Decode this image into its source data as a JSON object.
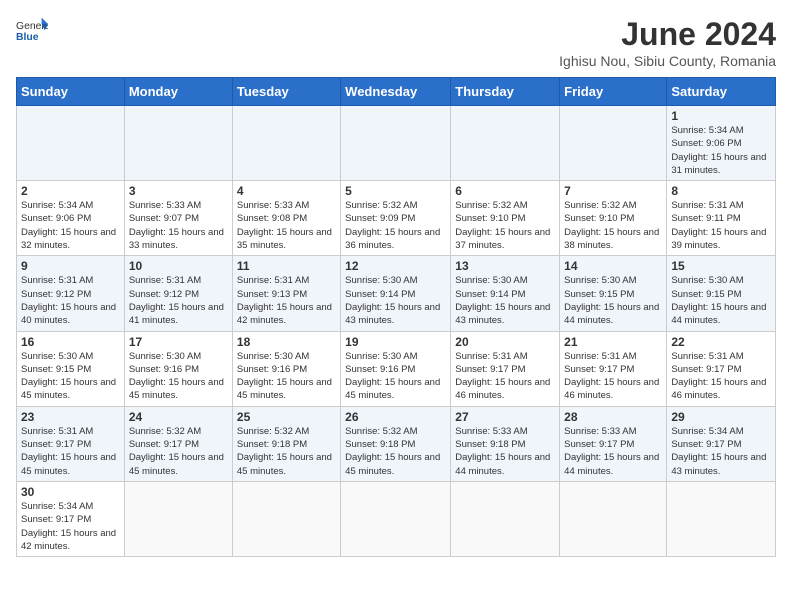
{
  "header": {
    "logo_general": "General",
    "logo_blue": "Blue",
    "month_year": "June 2024",
    "location": "Ighisu Nou, Sibiu County, Romania"
  },
  "days_of_week": [
    "Sunday",
    "Monday",
    "Tuesday",
    "Wednesday",
    "Thursday",
    "Friday",
    "Saturday"
  ],
  "weeks": [
    [
      {
        "day": "",
        "info": ""
      },
      {
        "day": "",
        "info": ""
      },
      {
        "day": "",
        "info": ""
      },
      {
        "day": "",
        "info": ""
      },
      {
        "day": "",
        "info": ""
      },
      {
        "day": "",
        "info": ""
      },
      {
        "day": "1",
        "info": "Sunrise: 5:34 AM\nSunset: 9:06 PM\nDaylight: 15 hours and 31 minutes."
      }
    ],
    [
      {
        "day": "2",
        "info": "Sunrise: 5:34 AM\nSunset: 9:06 PM\nDaylight: 15 hours and 32 minutes."
      },
      {
        "day": "3",
        "info": "Sunrise: 5:33 AM\nSunset: 9:07 PM\nDaylight: 15 hours and 33 minutes."
      },
      {
        "day": "4",
        "info": "Sunrise: 5:33 AM\nSunset: 9:08 PM\nDaylight: 15 hours and 35 minutes."
      },
      {
        "day": "5",
        "info": "Sunrise: 5:32 AM\nSunset: 9:09 PM\nDaylight: 15 hours and 36 minutes."
      },
      {
        "day": "6",
        "info": "Sunrise: 5:32 AM\nSunset: 9:10 PM\nDaylight: 15 hours and 37 minutes."
      },
      {
        "day": "7",
        "info": "Sunrise: 5:32 AM\nSunset: 9:10 PM\nDaylight: 15 hours and 38 minutes."
      },
      {
        "day": "8",
        "info": "Sunrise: 5:31 AM\nSunset: 9:11 PM\nDaylight: 15 hours and 39 minutes."
      }
    ],
    [
      {
        "day": "9",
        "info": "Sunrise: 5:31 AM\nSunset: 9:12 PM\nDaylight: 15 hours and 40 minutes."
      },
      {
        "day": "10",
        "info": "Sunrise: 5:31 AM\nSunset: 9:12 PM\nDaylight: 15 hours and 41 minutes."
      },
      {
        "day": "11",
        "info": "Sunrise: 5:31 AM\nSunset: 9:13 PM\nDaylight: 15 hours and 42 minutes."
      },
      {
        "day": "12",
        "info": "Sunrise: 5:30 AM\nSunset: 9:14 PM\nDaylight: 15 hours and 43 minutes."
      },
      {
        "day": "13",
        "info": "Sunrise: 5:30 AM\nSunset: 9:14 PM\nDaylight: 15 hours and 43 minutes."
      },
      {
        "day": "14",
        "info": "Sunrise: 5:30 AM\nSunset: 9:15 PM\nDaylight: 15 hours and 44 minutes."
      },
      {
        "day": "15",
        "info": "Sunrise: 5:30 AM\nSunset: 9:15 PM\nDaylight: 15 hours and 44 minutes."
      }
    ],
    [
      {
        "day": "16",
        "info": "Sunrise: 5:30 AM\nSunset: 9:15 PM\nDaylight: 15 hours and 45 minutes."
      },
      {
        "day": "17",
        "info": "Sunrise: 5:30 AM\nSunset: 9:16 PM\nDaylight: 15 hours and 45 minutes."
      },
      {
        "day": "18",
        "info": "Sunrise: 5:30 AM\nSunset: 9:16 PM\nDaylight: 15 hours and 45 minutes."
      },
      {
        "day": "19",
        "info": "Sunrise: 5:30 AM\nSunset: 9:16 PM\nDaylight: 15 hours and 45 minutes."
      },
      {
        "day": "20",
        "info": "Sunrise: 5:31 AM\nSunset: 9:17 PM\nDaylight: 15 hours and 46 minutes."
      },
      {
        "day": "21",
        "info": "Sunrise: 5:31 AM\nSunset: 9:17 PM\nDaylight: 15 hours and 46 minutes."
      },
      {
        "day": "22",
        "info": "Sunrise: 5:31 AM\nSunset: 9:17 PM\nDaylight: 15 hours and 46 minutes."
      }
    ],
    [
      {
        "day": "23",
        "info": "Sunrise: 5:31 AM\nSunset: 9:17 PM\nDaylight: 15 hours and 45 minutes."
      },
      {
        "day": "24",
        "info": "Sunrise: 5:32 AM\nSunset: 9:17 PM\nDaylight: 15 hours and 45 minutes."
      },
      {
        "day": "25",
        "info": "Sunrise: 5:32 AM\nSunset: 9:18 PM\nDaylight: 15 hours and 45 minutes."
      },
      {
        "day": "26",
        "info": "Sunrise: 5:32 AM\nSunset: 9:18 PM\nDaylight: 15 hours and 45 minutes."
      },
      {
        "day": "27",
        "info": "Sunrise: 5:33 AM\nSunset: 9:18 PM\nDaylight: 15 hours and 44 minutes."
      },
      {
        "day": "28",
        "info": "Sunrise: 5:33 AM\nSunset: 9:17 PM\nDaylight: 15 hours and 44 minutes."
      },
      {
        "day": "29",
        "info": "Sunrise: 5:34 AM\nSunset: 9:17 PM\nDaylight: 15 hours and 43 minutes."
      }
    ],
    [
      {
        "day": "30",
        "info": "Sunrise: 5:34 AM\nSunset: 9:17 PM\nDaylight: 15 hours and 42 minutes."
      },
      {
        "day": "",
        "info": ""
      },
      {
        "day": "",
        "info": ""
      },
      {
        "day": "",
        "info": ""
      },
      {
        "day": "",
        "info": ""
      },
      {
        "day": "",
        "info": ""
      },
      {
        "day": "",
        "info": ""
      }
    ]
  ]
}
